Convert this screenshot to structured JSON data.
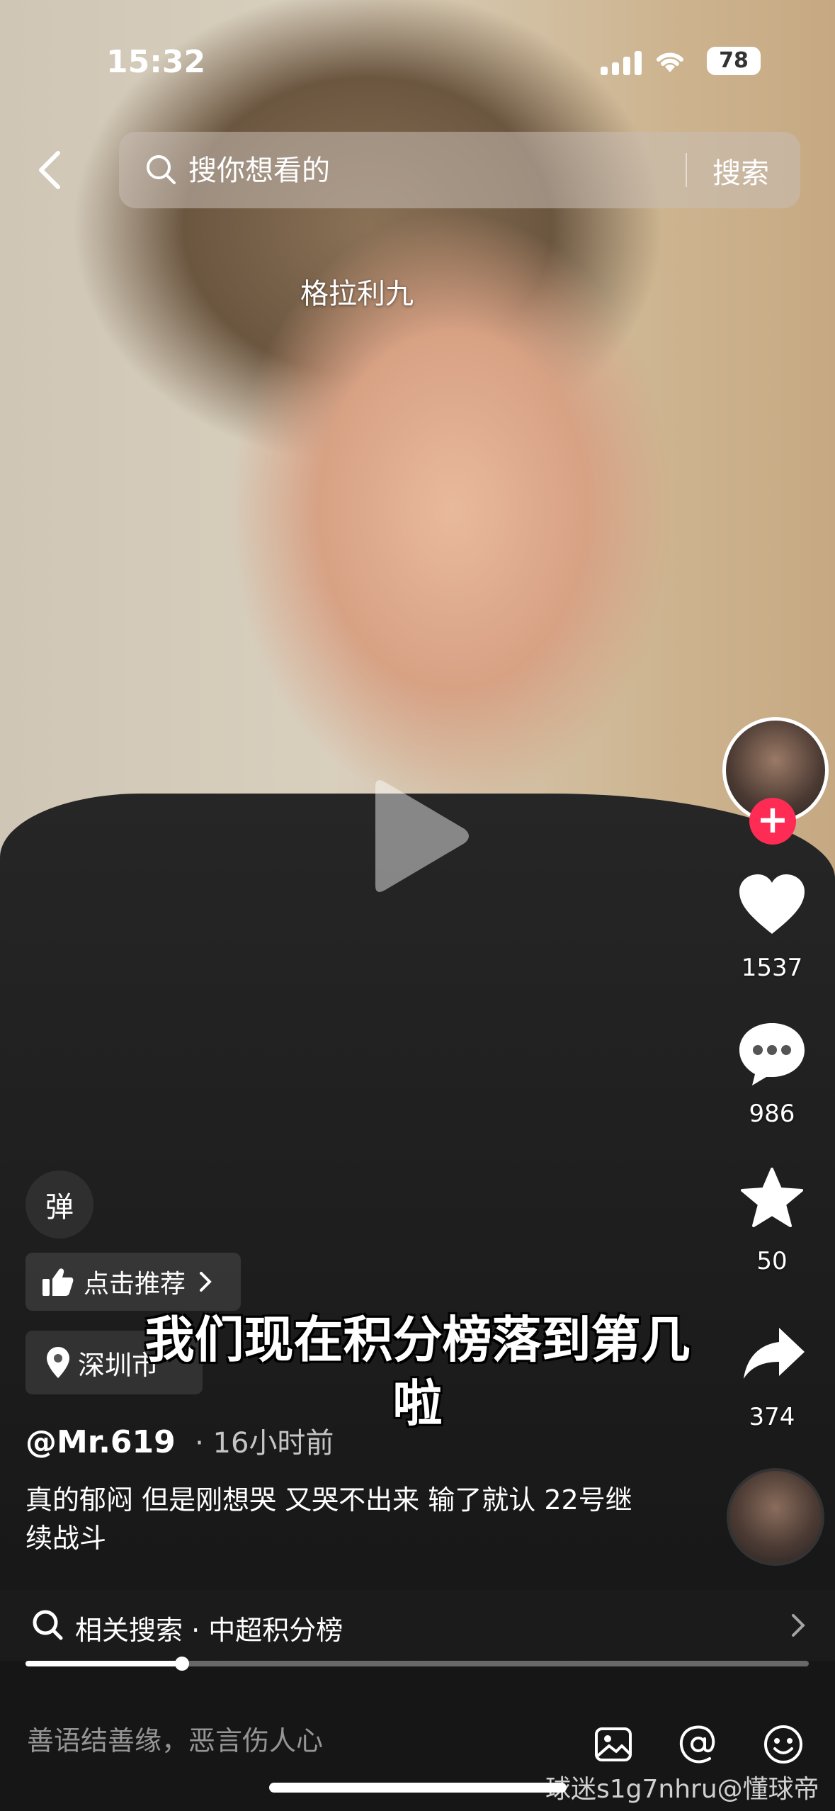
{
  "status_bar": {
    "time": "15:32",
    "battery": "78"
  },
  "search": {
    "placeholder": "搜你想看的",
    "button": "搜索"
  },
  "video": {
    "top_title": "格拉利九",
    "subtitle_line1": "我们现在积分榜落到第几",
    "subtitle_line2": "啦"
  },
  "actions": {
    "likes": "1537",
    "comments": "986",
    "favorites": "50",
    "shares": "374",
    "follow": "+"
  },
  "left_tools": {
    "danmu": "弹",
    "recommend": "点击推荐",
    "location": "深圳市"
  },
  "post": {
    "author": "@Mr.619",
    "time": "· 16小时前",
    "description": "真的郁闷 但是刚想哭 又哭不出来 输了就认 22号继续战斗"
  },
  "related_search": {
    "label": "相关搜索 · 中超积分榜"
  },
  "progress": {
    "fraction": 0.2
  },
  "comment": {
    "placeholder": "善语结善缘，恶言伤人心"
  },
  "watermark": "球迷s1g7nhru@懂球帝",
  "colors": {
    "accent": "#fe2c55"
  },
  "icons": [
    "back-icon",
    "search-icon",
    "heart-icon",
    "comment-icon",
    "star-icon",
    "share-icon",
    "image-icon",
    "at-icon",
    "emoji-icon",
    "location-pin-icon",
    "thumb-up-icon",
    "chevron-right-icon",
    "play-icon"
  ]
}
